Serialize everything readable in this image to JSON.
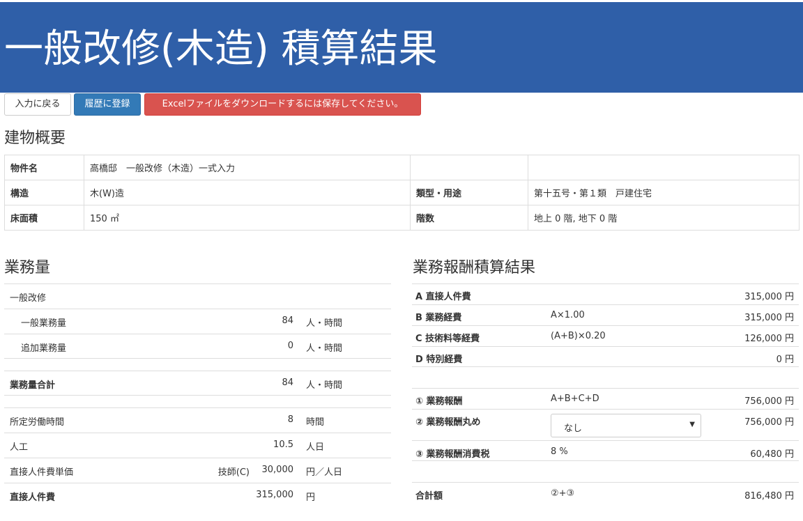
{
  "header": {
    "title": "一般改修(木造) 積算結果"
  },
  "toolbar": {
    "back_label": "入力に戻る",
    "history_label": "履歴に登録",
    "excel_label": "Excelファイルをダウンロードするには保存してください。"
  },
  "overview": {
    "title": "建物概要",
    "rows": [
      {
        "label": "物件名",
        "value": "高橋邸　一般改修（木造）一式入力",
        "label2": "",
        "value2": ""
      },
      {
        "label": "構造",
        "value": "木(W)造",
        "label2": "類型・用途",
        "value2": "第十五号・第１類　戸建住宅"
      },
      {
        "label": "床面積",
        "value": "150 ㎡",
        "label2": "階数",
        "value2": "地上 0 階, 地下 0 階"
      }
    ]
  },
  "volume": {
    "title": "業務量",
    "section": "一般改修",
    "general_label": "一般業務量",
    "general_value": "84",
    "general_unit": "人・時間",
    "additional_label": "追加業務量",
    "additional_value": "0",
    "additional_unit": "人・時間",
    "total_label": "業務量合計",
    "total_value": "84",
    "total_unit": "人・時間",
    "hours_label": "所定労働時間",
    "hours_value": "8",
    "hours_unit": "時間",
    "manday_label": "人工",
    "manday_value": "10.5",
    "manday_unit": "人日",
    "unitprice_label": "直接人件費単価",
    "unitprice_grade": "技師(C)",
    "unitprice_value": "30,000",
    "unitprice_unit": "円／人日",
    "direct_label": "直接人件費",
    "direct_value": "315,000",
    "direct_unit": "円"
  },
  "result": {
    "title": "業務報酬積算結果",
    "rows": [
      {
        "label": "A 直接人件費",
        "formula": "",
        "amount": "315,000 円"
      },
      {
        "label": "B 業務経費",
        "formula": "A×1.00",
        "amount": "315,000 円"
      },
      {
        "label": "C 技術料等経費",
        "formula": "(A+B)×0.20",
        "amount": "126,000 円"
      },
      {
        "label": "D 特別経費",
        "formula": "",
        "amount": "0 円"
      },
      {
        "label": "① 業務報酬",
        "formula": "A+B+C+D",
        "amount": "756,000 円"
      },
      {
        "label": "② 業務報酬丸め",
        "formula": "",
        "amount": "756,000 円"
      },
      {
        "label": "③ 業務報酬消費税",
        "formula": "8 %",
        "amount": "60,480 円"
      },
      {
        "label": "合計額",
        "formula": "②+③",
        "amount": "816,480 円"
      }
    ],
    "rounding_select": {
      "selected": "なし"
    }
  },
  "icons": {
    "select_caret": "chevron-down-icon"
  },
  "colors": {
    "header_bg": "#2f5fa8",
    "primary": "#337ab7",
    "danger": "#d9534f"
  }
}
